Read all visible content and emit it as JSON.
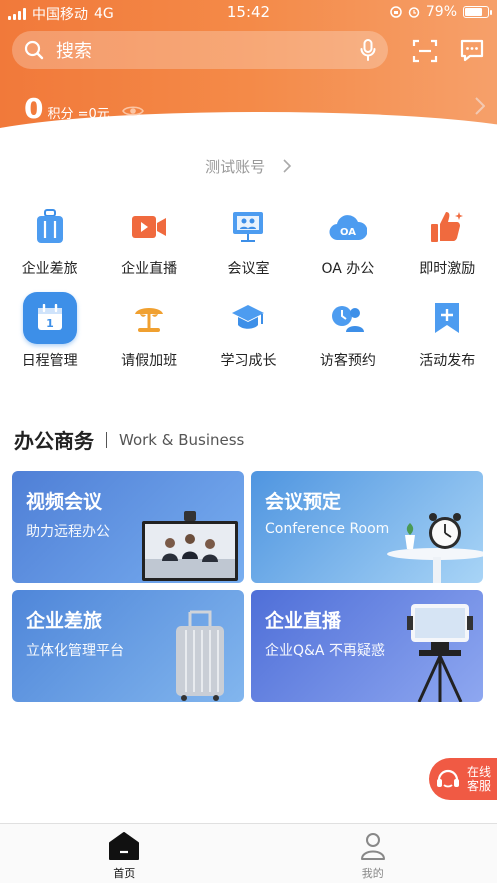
{
  "status_bar": {
    "carrier": "中国移动",
    "network": "4G",
    "time": "15:42",
    "battery": "79%"
  },
  "search": {
    "placeholder": "搜索"
  },
  "points": {
    "value": "0",
    "label": "积分 =0元"
  },
  "account": {
    "label": "测试账号"
  },
  "apps_row1": [
    {
      "label": "企业差旅",
      "icon": "luggage-icon",
      "color": "#3d8fe8"
    },
    {
      "label": "企业直播",
      "icon": "video-camera-icon",
      "color": "#f06a3e"
    },
    {
      "label": "会议室",
      "icon": "meeting-room-icon",
      "color": "#3d8fe8"
    },
    {
      "label": "OA 办公",
      "icon": "oa-cloud-icon",
      "color": "#3d8fe8"
    },
    {
      "label": "即时激励",
      "icon": "thumbs-up-icon",
      "color": "#f06a3e"
    }
  ],
  "apps_row2": [
    {
      "label": "日程管理",
      "icon": "calendar-icon",
      "color": "#3d8fe8"
    },
    {
      "label": "请假加班",
      "icon": "beach-umbrella-icon",
      "color": "#f0a030"
    },
    {
      "label": "学习成长",
      "icon": "graduation-cap-icon",
      "color": "#3d8fe8"
    },
    {
      "label": "访客预约",
      "icon": "visitor-icon",
      "color": "#3d8fe8"
    },
    {
      "label": "活动发布",
      "icon": "bookmark-plus-icon",
      "color": "#3d8fe8"
    }
  ],
  "section": {
    "title_cn": "办公商务",
    "title_en": "Work & Business"
  },
  "cards": [
    {
      "title": "视频会议",
      "subtitle": "助力远程办公"
    },
    {
      "title": "会议预定",
      "subtitle": "Conference Room"
    },
    {
      "title": "企业差旅",
      "subtitle": "立体化管理平台"
    },
    {
      "title": "企业直播",
      "subtitle": "企业Q&A 不再疑惑"
    }
  ],
  "service": {
    "line1": "在线",
    "line2": "客服"
  },
  "tabs": [
    {
      "label": "首页",
      "icon": "home-icon",
      "active": true
    },
    {
      "label": "我的",
      "icon": "profile-icon",
      "active": false
    }
  ]
}
